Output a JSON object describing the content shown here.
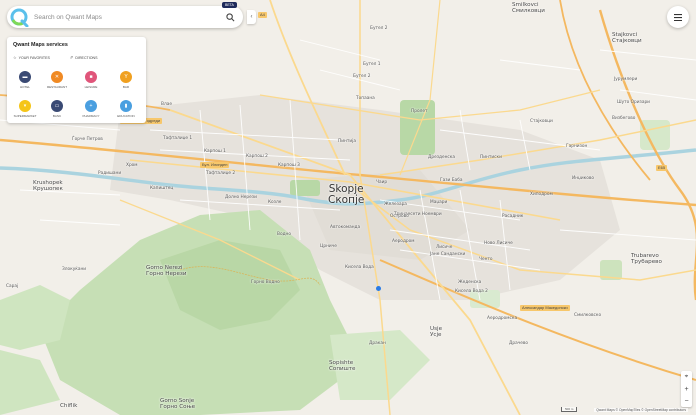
{
  "colors": {
    "background": "#f2efe9",
    "forest": "#c6dfb5",
    "park": "#b8d8a6",
    "urban": "#e4e1db",
    "motorway": "#f4b860",
    "major_road": "#fbd98e",
    "minor_road": "#ffffff",
    "river": "#aad3df",
    "accent": "#2a7be4"
  },
  "search": {
    "placeholder": "Search on Qwant Maps",
    "beta": "BETA",
    "logo_icon": "qwant-q-icon",
    "search_icon": "magnifier-icon"
  },
  "services": {
    "title": "Qwant Maps services",
    "favorites_label": "YOUR FAVORITES",
    "directions_label": "DIRECTIONS",
    "items": [
      {
        "label": "HOTEL",
        "icon": "bed-icon",
        "color": "#3a4a74"
      },
      {
        "label": "RESTAURANT",
        "icon": "cutlery-icon",
        "color": "#f08a24"
      },
      {
        "label": "LEISURE",
        "icon": "ticket-icon",
        "color": "#e0557a"
      },
      {
        "label": "BAR",
        "icon": "cocktail-icon",
        "color": "#f0a020"
      },
      {
        "label": "SUPERMARKET",
        "icon": "basket-icon",
        "color": "#f5c518"
      },
      {
        "label": "BANK",
        "icon": "money-icon",
        "color": "#3a4a74"
      },
      {
        "label": "PHARMACY",
        "icon": "pharmacy-icon",
        "color": "#4a9fe0"
      },
      {
        "label": "EDUCATION",
        "icon": "education-icon",
        "color": "#4a9fe0"
      }
    ]
  },
  "map": {
    "city": {
      "line1": "Skopje",
      "line2": "Скопје"
    },
    "places": [
      {
        "t": "Smilkovci\nСмилковци"
      },
      {
        "t": "Stajkovci\nСтајковци"
      },
      {
        "t": "Krushopek\nКрушопек"
      },
      {
        "t": "Gorno Nerezi\nГорно Нерези"
      },
      {
        "t": "Sopishte\nСопиште"
      },
      {
        "t": "Trubarevo\nТрубарево"
      },
      {
        "t": "Usje\nУсје"
      },
      {
        "t": "Gorno Sonje\nГорно Соње"
      },
      {
        "t": "Chiflik"
      }
    ],
    "streets": [
      "Бутел 2",
      "Бутел 1",
      "Бутел 2",
      "Топаана",
      "Влае",
      "Карпош 1",
      "Карпош 2",
      "Карпош 3",
      "Тафталиџе 1",
      "Тафталиџе 2",
      "Козле",
      "Долно Нерези",
      "Хром",
      "Кисела Вода",
      "Водно",
      "Аеродром",
      "Лисиче",
      "Ново Лисиче",
      "Јане Сандански",
      "Маџари",
      "Автокоманда",
      "Железара",
      "Гази Баба",
      "Чаир",
      "Пинтија",
      "Тринаесети Ноември",
      "Црниче",
      "Острово",
      "Ѓорче Петров",
      "Сарај",
      "Злокуќани",
      "Радишани",
      "Пролет",
      "Дрезденска",
      "Жеденска",
      "Расадник",
      "Капиштец",
      "Пинтиски",
      "Ченто",
      "Визбегово",
      "Драчево",
      "Горно Водно",
      "Дракан",
      "Гарнизон",
      "Шуто Оризари",
      "Хиподром",
      "Инџиково",
      "Стајковци",
      "Јурумлери",
      "Аеродромска",
      "Кисела Вода 2",
      "Смилковско"
    ],
    "roads": [
      "А4",
      "E65",
      "Бул. Илинден",
      "Партизански одреди",
      "Александар Македонски"
    ],
    "location_marker": "current-location-icon"
  },
  "menu_icon": "hamburger-menu-icon",
  "controls": {
    "locate_icon": "crosshair-icon",
    "zoom_in": "+",
    "zoom_out": "−"
  },
  "scale": "500 m",
  "attribution": "Qwant Maps © OpenMapTiles © OpenStreetMap contributors"
}
